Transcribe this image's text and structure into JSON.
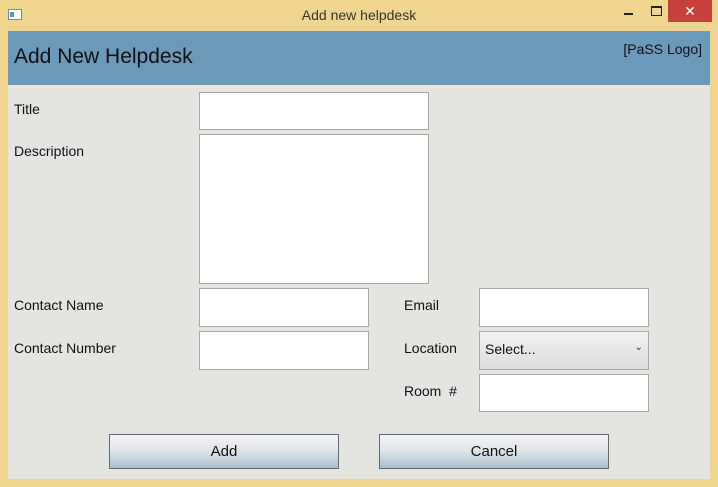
{
  "window": {
    "title": "Add new helpdesk",
    "close_glyph": "✕"
  },
  "header": {
    "title": "Add New Helpdesk",
    "logo_text": "[PaSS Logo]"
  },
  "form": {
    "title_label": "Title",
    "description_label": "Description",
    "contact_name_label": "Contact Name",
    "contact_number_label": "Contact Number",
    "email_label": "Email",
    "location_label": "Location",
    "location_selected": "Select...",
    "room_label": "Room  #",
    "title_value": "",
    "description_value": "",
    "contact_name_value": "",
    "contact_number_value": "",
    "email_value": "",
    "room_value": ""
  },
  "buttons": {
    "add_label": "Add",
    "cancel_label": "Cancel"
  },
  "icons": {
    "dropdown": "chevron-down-icon",
    "app": "window-app-icon"
  },
  "colors": {
    "frame": "#f0d58e",
    "header": "#6a99b9",
    "client": "#e4e4e1",
    "close": "#c7403a"
  }
}
